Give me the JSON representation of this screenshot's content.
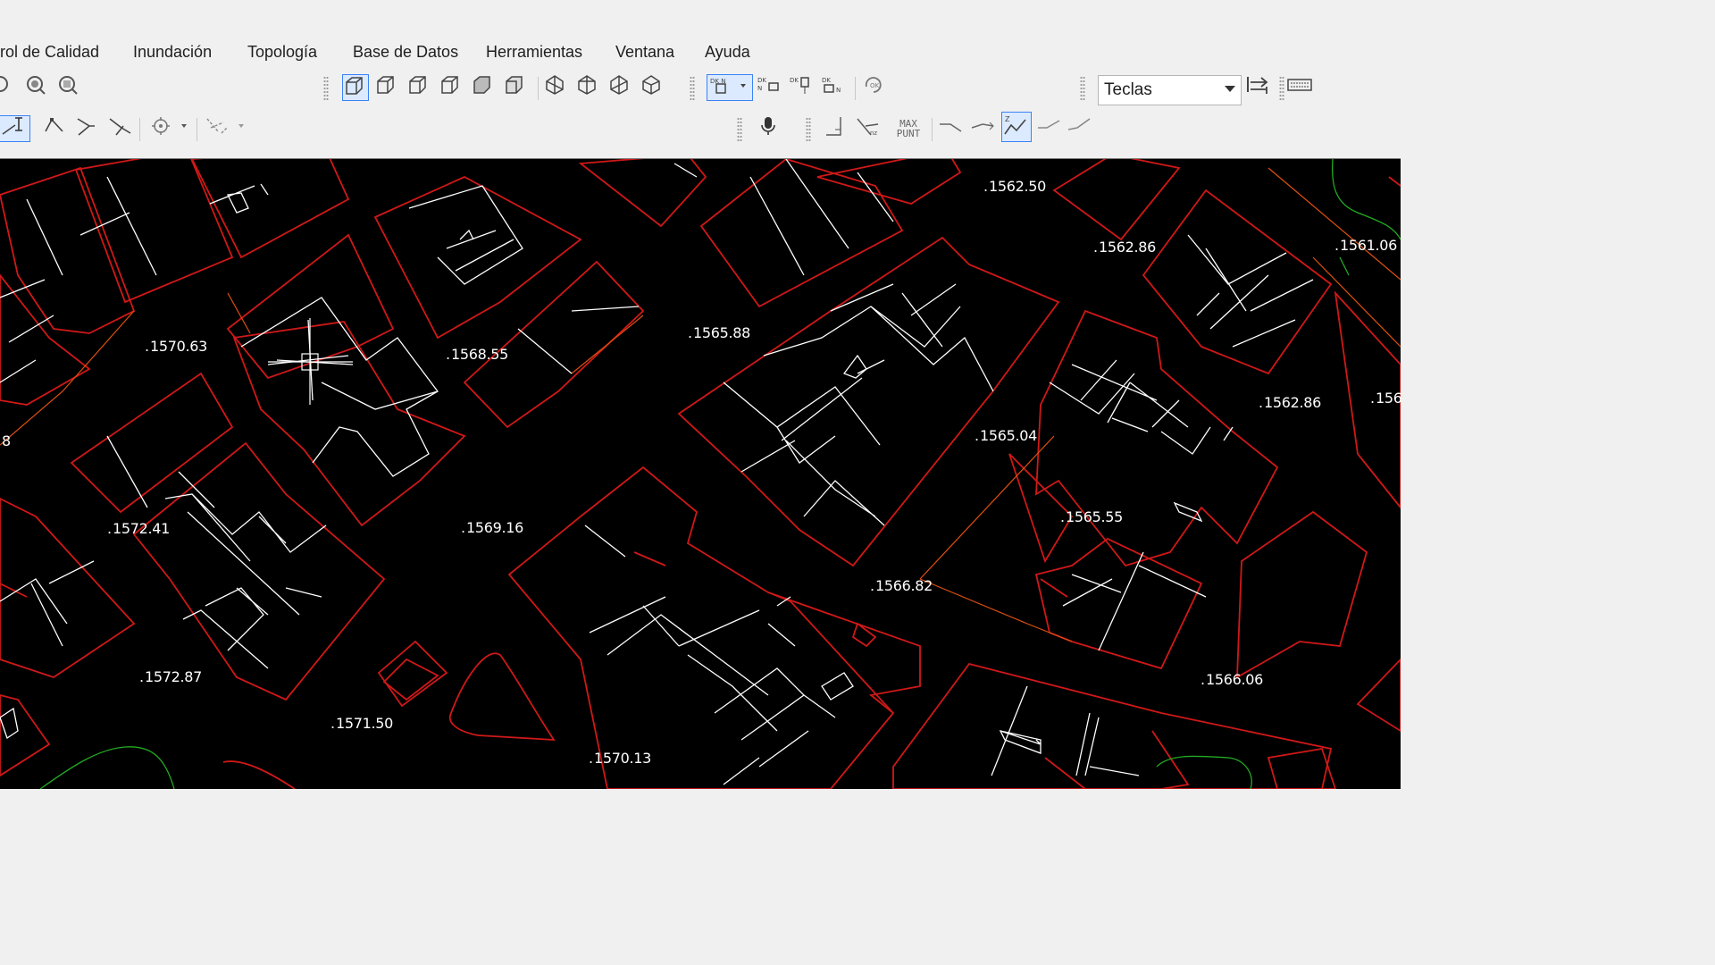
{
  "menu": {
    "items": [
      "rol de Calidad",
      "Inundación",
      "Topología",
      "Base de Datos",
      "Herramientas",
      "Ventana",
      "Ayuda"
    ]
  },
  "toolbar": {
    "input_mode": "Teclas",
    "max_punt_line1": "MAX",
    "max_punt_line2": "PUNT"
  },
  "map": {
    "elevations": [
      "1562.50",
      "1562.86",
      "1561.06",
      "1570.63",
      "1568.55",
      "1565.88",
      "1562.86",
      "156",
      "1565.04",
      "8",
      "1565.55",
      "1572.41",
      "1569.16",
      "1566.82",
      "1572.87",
      "1566.06",
      "1571.50",
      "1570.13"
    ],
    "colors": {
      "parcel": "#d01818",
      "building": "#ffffff",
      "contour": "#22aa22",
      "road": "#e05010"
    }
  }
}
